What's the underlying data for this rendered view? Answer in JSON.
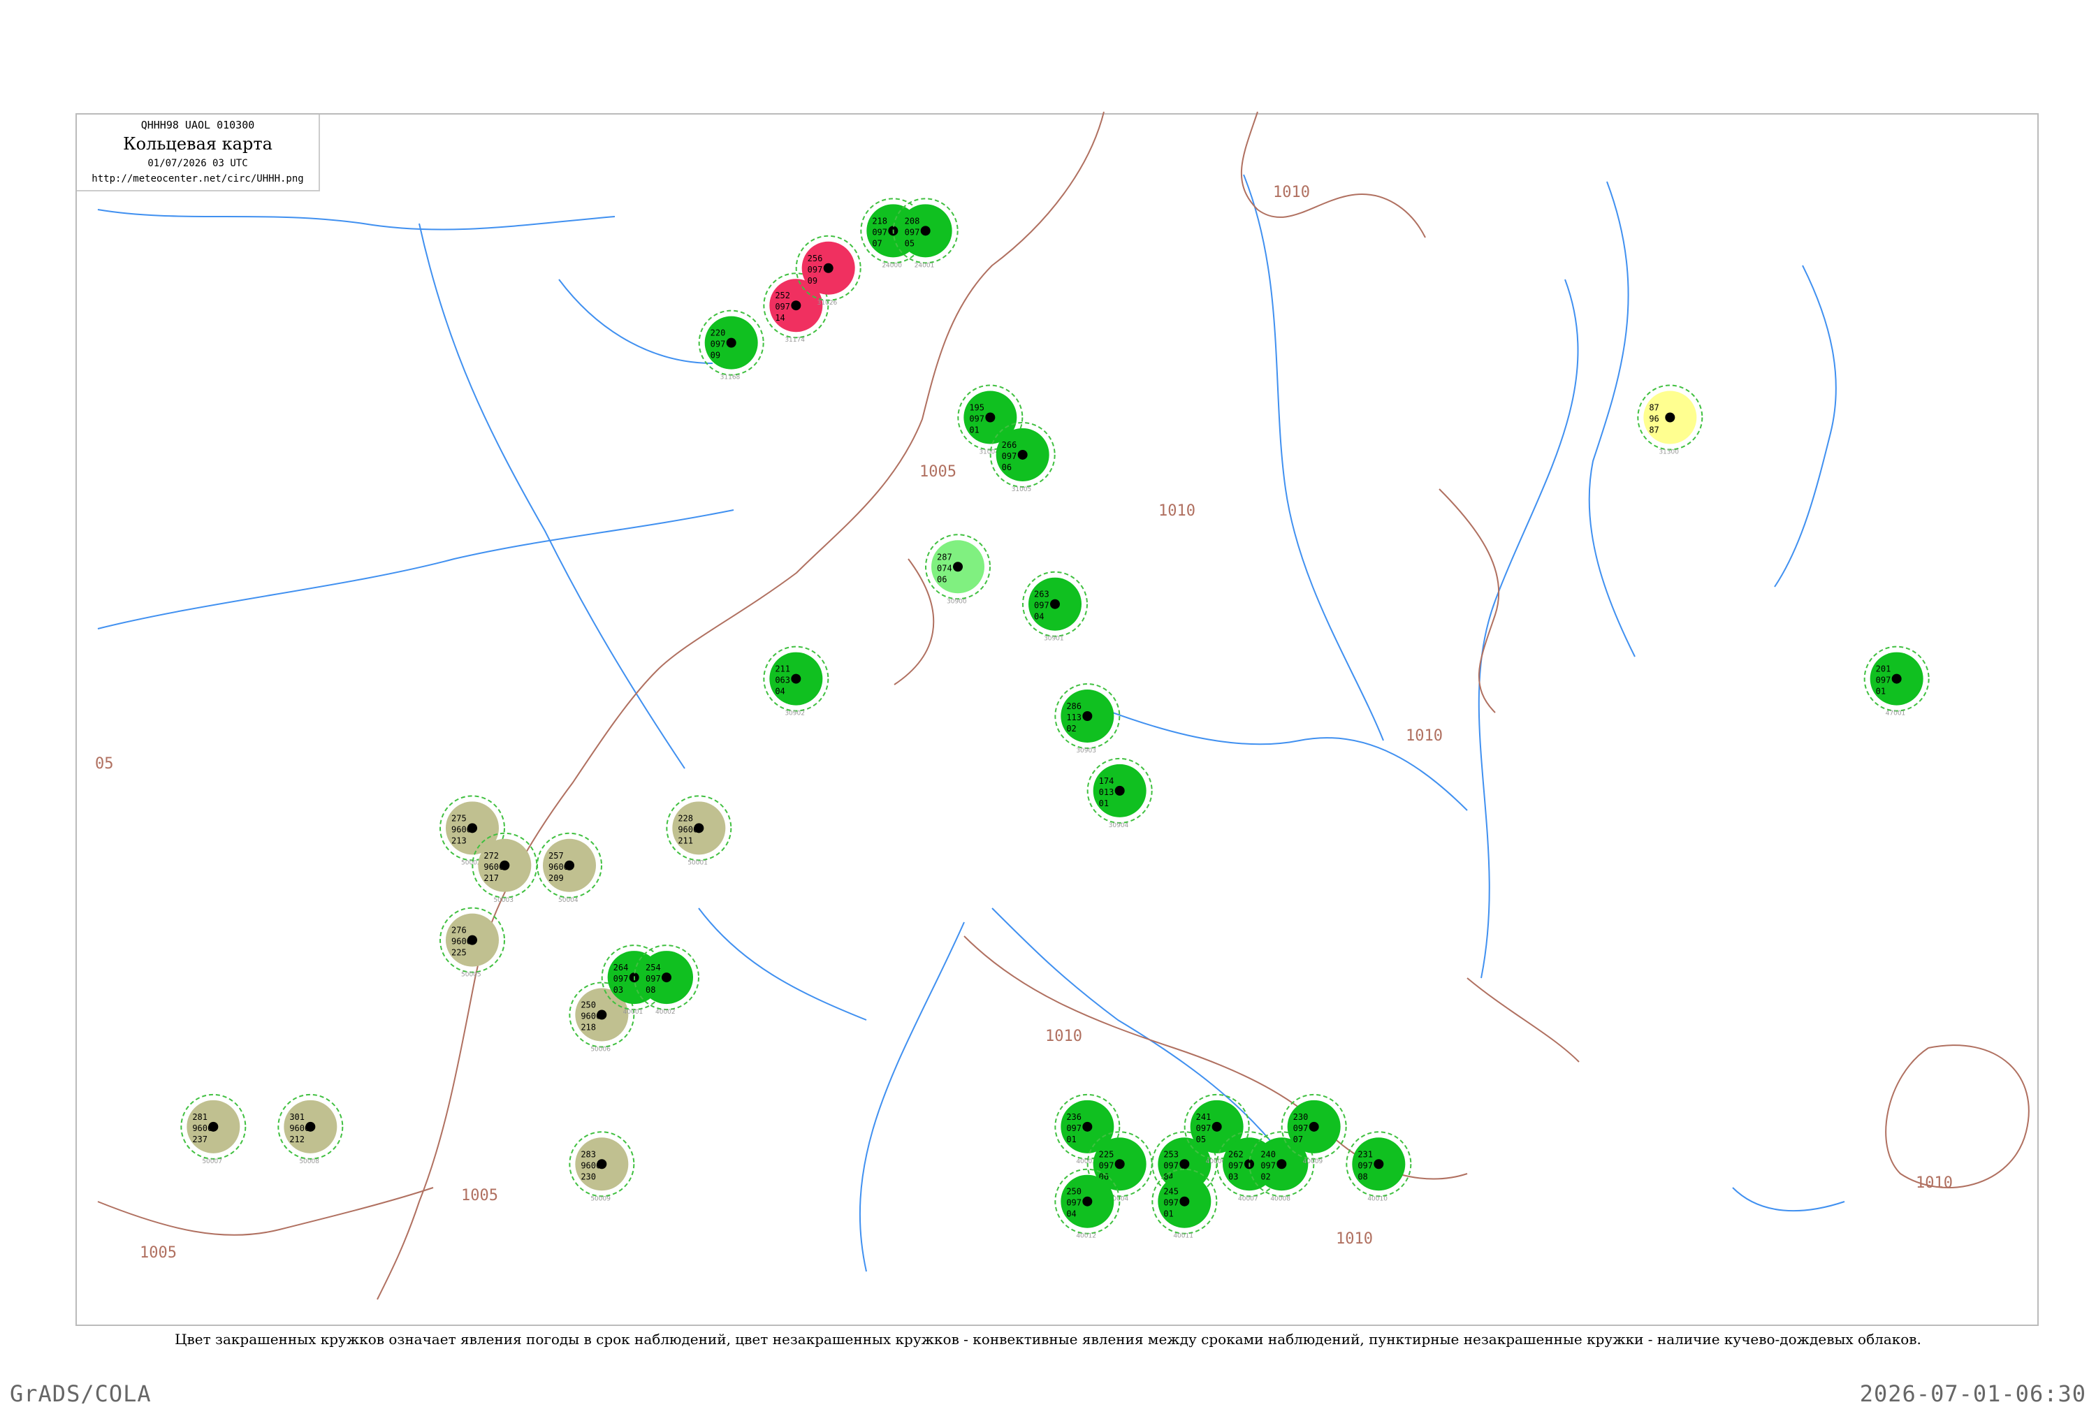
{
  "header": {
    "code": "QHHH98  UAOL  010300",
    "title": "Кольцевая карта",
    "date": "01/07/2026 03 UTC",
    "url": "http://meteocenter.net/circ/UHHH.png"
  },
  "caption": "Цвет закрашенных кружков означает явления погоды в срок наблюдений, цвет незакрашенных кружков - конвективные явления между сроками наблюдений, пунктирные незакрашенные кружки - наличие кучево-дождевых облаков.",
  "footer": {
    "left": "GrADS/COLA",
    "right": "2026-07-01-06:30"
  },
  "colors": {
    "rain": "#10c020",
    "light_rain": "#80f080",
    "thunder": "#f03060",
    "fog": "#c0c090",
    "haze": "#ffff90",
    "cb_dashed": "#40c040",
    "isobar": "#b07060",
    "river": "#4090f0"
  },
  "chart_data": {
    "type": "map",
    "isobars": [
      {
        "label": "1010"
      },
      {
        "label": "1005"
      },
      {
        "label": "1010"
      },
      {
        "label": "1010"
      },
      {
        "label": "1010"
      },
      {
        "label": "1010"
      },
      {
        "label": "1005"
      },
      {
        "label": "1005"
      },
      {
        "label": "1010"
      },
      {
        "label": "05"
      }
    ],
    "stations": [
      {
        "id": "31168",
        "lat": 56,
        "lon": 60,
        "kind": "rain",
        "t": "220",
        "td": "097",
        "p": "09"
      },
      {
        "id": "31174",
        "lat": 57,
        "lon": 62,
        "kind": "thunder",
        "t": "252",
        "td": "097",
        "p": "14"
      },
      {
        "id": "31026",
        "lat": 58,
        "lon": 63,
        "kind": "thunder",
        "t": "256",
        "td": "097",
        "p": "09"
      },
      {
        "id": "24000",
        "lat": 59,
        "lon": 65,
        "kind": "rain",
        "t": "218",
        "td": "097",
        "p": "07"
      },
      {
        "id": "24001",
        "lat": 59,
        "lon": 66,
        "kind": "rain",
        "t": "208",
        "td": "097",
        "p": "05"
      },
      {
        "id": "31004",
        "lat": 54,
        "lon": 68,
        "kind": "rain",
        "t": "195",
        "td": "097",
        "p": "01"
      },
      {
        "id": "31005",
        "lat": 53,
        "lon": 69,
        "kind": "rain",
        "t": "266",
        "td": "097",
        "p": "06"
      },
      {
        "id": "30900",
        "lat": 50,
        "lon": 67,
        "kind": "light_rain",
        "t": "287",
        "td": "074",
        "p": "06"
      },
      {
        "id": "30901",
        "lat": 49,
        "lon": 70,
        "kind": "rain",
        "t": "263",
        "td": "097",
        "p": "04"
      },
      {
        "id": "30902",
        "lat": 47,
        "lon": 62,
        "kind": "rain",
        "t": "211",
        "td": "063",
        "p": "04"
      },
      {
        "id": "30903",
        "lat": 46,
        "lon": 71,
        "kind": "rain",
        "t": "286",
        "td": "113",
        "p": "02"
      },
      {
        "id": "30904",
        "lat": 44,
        "lon": 72,
        "kind": "rain",
        "t": "174",
        "td": "013",
        "p": "01"
      },
      {
        "id": "50001",
        "lat": 43,
        "lon": 59,
        "kind": "fog",
        "t": "228",
        "td": "9600",
        "p": "211"
      },
      {
        "id": "50002",
        "lat": 43,
        "lon": 52,
        "kind": "fog",
        "t": "275",
        "td": "9600",
        "p": "213"
      },
      {
        "id": "50003",
        "lat": 42,
        "lon": 53,
        "kind": "fog",
        "t": "272",
        "td": "9600",
        "p": "217"
      },
      {
        "id": "50004",
        "lat": 42,
        "lon": 55,
        "kind": "fog",
        "t": "257",
        "td": "9600",
        "p": "209"
      },
      {
        "id": "50005",
        "lat": 40,
        "lon": 52,
        "kind": "fog",
        "t": "276",
        "td": "9600",
        "p": "225"
      },
      {
        "id": "50006",
        "lat": 38,
        "lon": 56,
        "kind": "fog",
        "t": "250",
        "td": "9600",
        "p": "218"
      },
      {
        "id": "50007",
        "lat": 35,
        "lon": 44,
        "kind": "fog",
        "t": "281",
        "td": "9600",
        "p": "237"
      },
      {
        "id": "50008",
        "lat": 35,
        "lon": 47,
        "kind": "fog",
        "t": "301",
        "td": "9600",
        "p": "212"
      },
      {
        "id": "50009",
        "lat": 34,
        "lon": 56,
        "kind": "fog",
        "t": "283",
        "td": "9600",
        "p": "230"
      },
      {
        "id": "40001",
        "lat": 39,
        "lon": 57,
        "kind": "rain",
        "t": "264",
        "td": "097",
        "p": "03"
      },
      {
        "id": "40002",
        "lat": 39,
        "lon": 58,
        "kind": "rain",
        "t": "254",
        "td": "097",
        "p": "08"
      },
      {
        "id": "40003",
        "lat": 35,
        "lon": 71,
        "kind": "rain",
        "t": "236",
        "td": "097",
        "p": "01"
      },
      {
        "id": "40004",
        "lat": 34,
        "lon": 72,
        "kind": "rain",
        "t": "225",
        "td": "097",
        "p": "06"
      },
      {
        "id": "40005",
        "lat": 34,
        "lon": 74,
        "kind": "rain",
        "t": "253",
        "td": "097",
        "p": "04"
      },
      {
        "id": "40006",
        "lat": 35,
        "lon": 75,
        "kind": "rain",
        "t": "241",
        "td": "097",
        "p": "05"
      },
      {
        "id": "40007",
        "lat": 34,
        "lon": 76,
        "kind": "rain",
        "t": "262",
        "td": "097",
        "p": "03"
      },
      {
        "id": "40008",
        "lat": 34,
        "lon": 77,
        "kind": "rain",
        "t": "240",
        "td": "097",
        "p": "02"
      },
      {
        "id": "40009",
        "lat": 35,
        "lon": 78,
        "kind": "rain",
        "t": "230",
        "td": "097",
        "p": "07"
      },
      {
        "id": "40010",
        "lat": 34,
        "lon": 80,
        "kind": "rain",
        "t": "231",
        "td": "097",
        "p": "08"
      },
      {
        "id": "40011",
        "lat": 33,
        "lon": 74,
        "kind": "rain",
        "t": "245",
        "td": "097",
        "p": "01"
      },
      {
        "id": "40012",
        "lat": 33,
        "lon": 71,
        "kind": "rain",
        "t": "250",
        "td": "097",
        "p": "04"
      },
      {
        "id": "47001",
        "lat": 47,
        "lon": 96,
        "kind": "rain",
        "t": "201",
        "td": "097",
        "p": "01"
      },
      {
        "id": "31300",
        "lat": 54,
        "lon": 89,
        "kind": "haze",
        "t": "87",
        "td": "96",
        "p": "87"
      }
    ]
  }
}
